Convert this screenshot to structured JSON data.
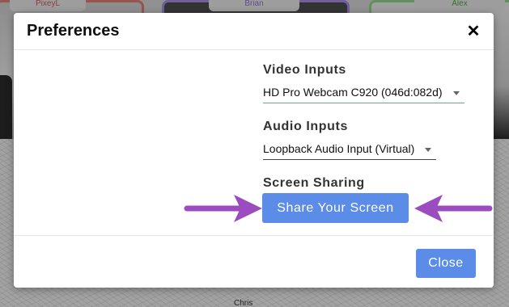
{
  "participants": {
    "left": "PixeyL",
    "middle": "Brian",
    "right": "Alex",
    "bottom": "Chris"
  },
  "dialog": {
    "title": "Preferences",
    "close_icon_glyph": "✕",
    "video_inputs": {
      "label": "Video Inputs",
      "selected": "HD Pro Webcam C920 (046d:082d)"
    },
    "audio_inputs": {
      "label": "Audio Inputs",
      "selected": "Loopback Audio Input (Virtual)"
    },
    "screen_sharing": {
      "label": "Screen Sharing",
      "button_label": "Share Your Screen"
    },
    "footer": {
      "close_label": "Close"
    }
  },
  "icons": {
    "close": "close-icon",
    "dropdown": "chevron-down-icon",
    "annotation": "arrow-annotation-icon"
  },
  "colors": {
    "primary_button": "#5b8de8",
    "annotation_arrow": "#9b4dbf",
    "tile_left_border": "#e07d74",
    "tile_middle_border": "#a58ce0",
    "tile_right_border": "#8fd48a"
  }
}
